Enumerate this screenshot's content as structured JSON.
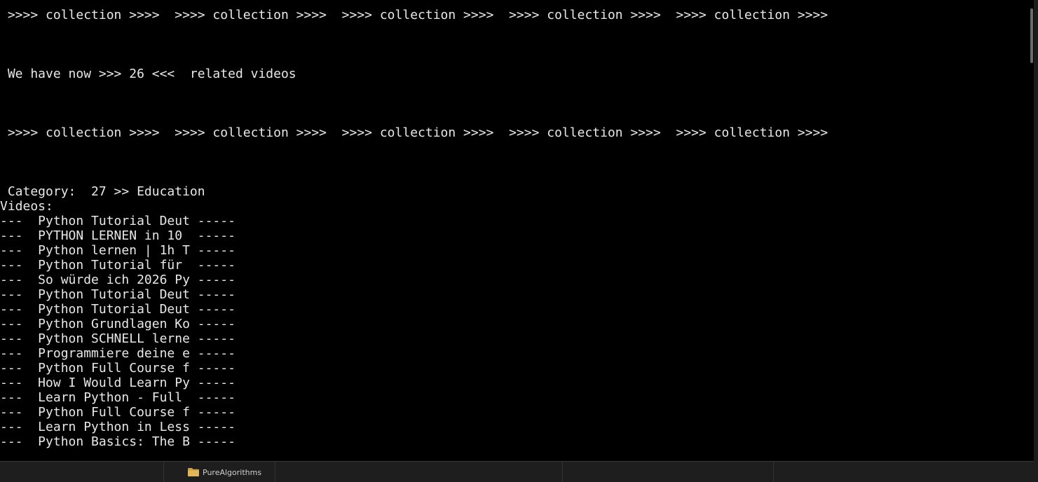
{
  "terminal": {
    "lines": [
      " >>>> collection >>>>  >>>> collection >>>>  >>>> collection >>>>  >>>> collection >>>>  >>>> collection >>>>",
      " We have now >>> 26 <<<  related videos",
      " >>>> collection >>>>  >>>> collection >>>>  >>>> collection >>>>  >>>> collection >>>>  >>>> collection >>>>",
      " Category:  27 >> Education",
      "Videos:",
      "---  Python Tutorial Deut -----",
      "---  PYTHON LERNEN in 10  -----",
      "---  Python lernen | 1h T -----",
      "---  Python Tutorial für  -----",
      "---  So würde ich 2026 Py -----",
      "---  Python Tutorial Deut -----",
      "---  Python Tutorial Deut -----",
      "---  Python Grundlagen Ko -----",
      "---  Python SCHNELL lerne -----",
      "---  Programmiere deine e -----",
      "---  Python Full Course f -----",
      "---  How I Would Learn Py -----",
      "---  Learn Python - Full  -----",
      "---  Python Full Course f -----",
      "---  Learn Python in Less -----",
      "---  Python Basics: The B -----"
    ]
  },
  "taskbar": {
    "folder_label": "PureAlgorithms",
    "folder_icon": "folder-icon",
    "folder_color": "#c8a24a"
  },
  "colors": {
    "terminal_bg": "#000000",
    "terminal_fg": "#e8e8e8"
  }
}
